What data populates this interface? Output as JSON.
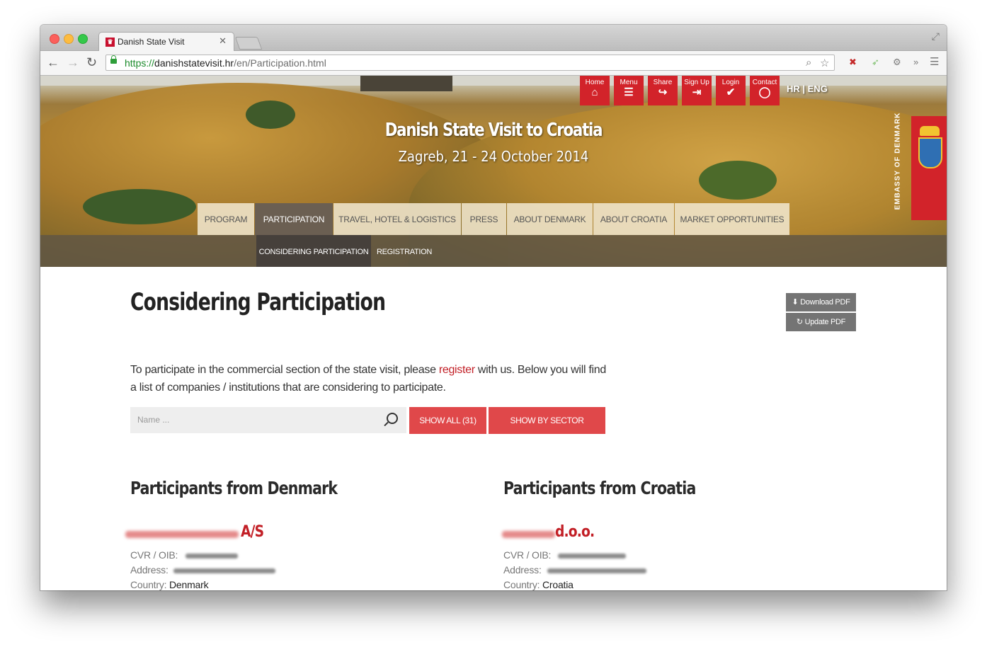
{
  "browser": {
    "tab_title": "Danish State Visit",
    "url_scheme": "https://",
    "url_host": "danishstatevisit.hr",
    "url_path": "/en/Participation.html"
  },
  "site": {
    "title": "Danish State Visit to Croatia",
    "subtitle": "Zagreb, 21 - 24 October 2014",
    "embassy_label": "Embassy of Denmark",
    "language": "HR | ENG",
    "top_icons": [
      {
        "label": "Home",
        "icon": "home-icon"
      },
      {
        "label": "Menu",
        "icon": "menu-icon"
      },
      {
        "label": "Share",
        "icon": "share-icon"
      },
      {
        "label": "Sign Up",
        "icon": "sign-up-icon"
      },
      {
        "label": "Login",
        "icon": "check-icon"
      },
      {
        "label": "Contact",
        "icon": "speech-bubble-icon"
      }
    ],
    "accent_color": "#d2232a",
    "button_color": "#e0484a"
  },
  "nav": {
    "items": [
      "PROGRAM",
      "PARTICIPATION",
      "TRAVEL, HOTEL & LOGISTICS",
      "PRESS",
      "ABOUT DENMARK",
      "ABOUT CROATIA",
      "MARKET OPPORTUNITIES"
    ],
    "active": "PARTICIPATION",
    "sub_items": [
      "CONSIDERING PARTICIPATION",
      "REGISTRATION"
    ],
    "sub_active": "CONSIDERING PARTICIPATION"
  },
  "page": {
    "title": "Considering Participation",
    "download_pdf": "Download PDF",
    "update_pdf": "Update PDF",
    "intro_before": "To participate in the commercial section of the state visit, please ",
    "intro_link": "register",
    "intro_after": " with us. Below you will find a list of companies / institutions that are considering to participate.",
    "search_placeholder": "Name ...",
    "show_all": "SHOW ALL (31)",
    "show_by_sector": "SHOW BY SECTOR"
  },
  "columns": [
    {
      "heading": "Participants from Denmark",
      "company_suffix": "A/S",
      "cvr_label": "CVR / OIB:",
      "address_label": "Address:",
      "country_label": "Country:",
      "country": "Denmark"
    },
    {
      "heading": "Participants from Croatia",
      "company_suffix": "d.o.o.",
      "cvr_label": "CVR / OIB:",
      "address_label": "Address:",
      "country_label": "Country:",
      "country": "Croatia"
    }
  ]
}
